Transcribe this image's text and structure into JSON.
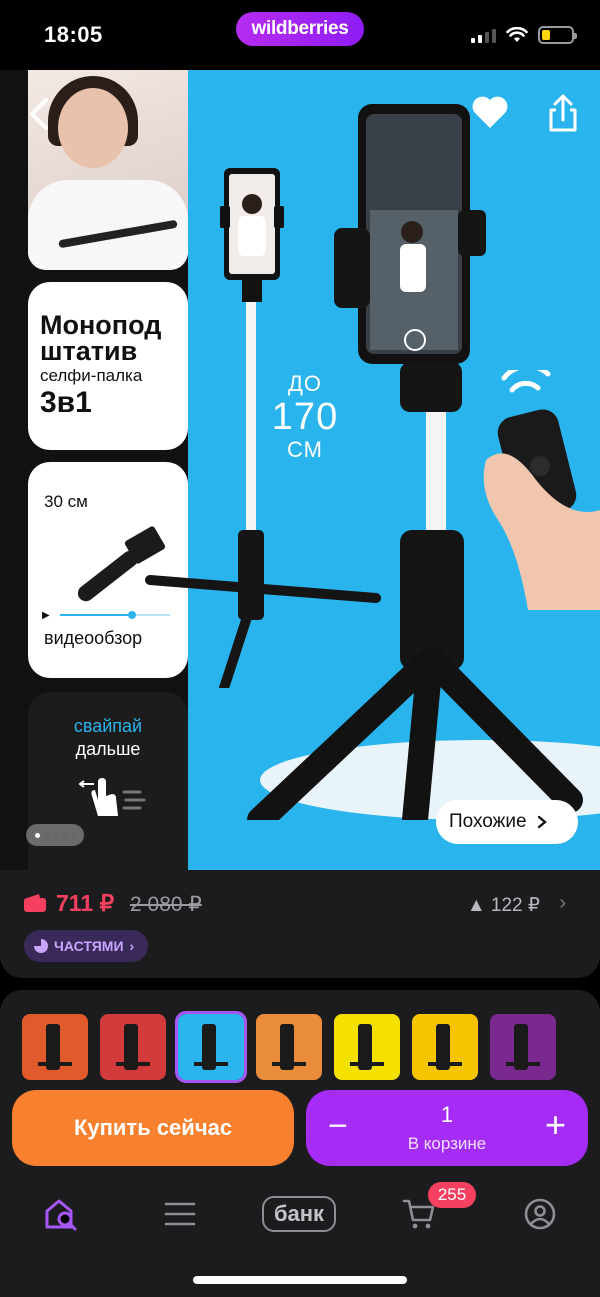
{
  "status_bar": {
    "time": "18:05",
    "brand": "wildberries"
  },
  "product_image": {
    "card_title": "Монопод штатив",
    "card_subtitle": "селфи-палка",
    "card_variant": "3в1",
    "folded_length": "30 см",
    "video_label": "видеообзор",
    "video_progress": 0.65,
    "height_prefix": "ДО",
    "height_value": "170",
    "height_unit": "СМ",
    "swipe_line1": "свайпай",
    "swipe_line2": "дальше",
    "gallery_position": 1,
    "gallery_total": 5,
    "similar_label": "Похожие"
  },
  "price": {
    "current": "711 ₽",
    "old": "2 080 ₽",
    "change": "▲ 122 ₽",
    "installment_label": "ЧАСТЯМИ"
  },
  "thumbnails": [
    {
      "bg": "#e05a2b",
      "selected": false
    },
    {
      "bg": "#d23b3b",
      "selected": false
    },
    {
      "bg": "#2bb5ee",
      "selected": true
    },
    {
      "bg": "#e98c3b",
      "selected": false
    },
    {
      "bg": "#f5e100",
      "selected": false
    },
    {
      "bg": "#f7c500",
      "selected": false
    },
    {
      "bg": "#7a2a8e",
      "selected": false
    }
  ],
  "actions": {
    "buy_now": "Купить сейчас",
    "quantity": "1",
    "in_cart": "В корзине",
    "minus": "−",
    "plus": "+"
  },
  "tabbar": {
    "bank": "банк",
    "cart_badge": "255"
  },
  "colors": {
    "hero_bg": "#29b4ee",
    "accent_purple": "#a42cf4",
    "buy_orange": "#f7812e",
    "price_red": "#f5415f"
  }
}
